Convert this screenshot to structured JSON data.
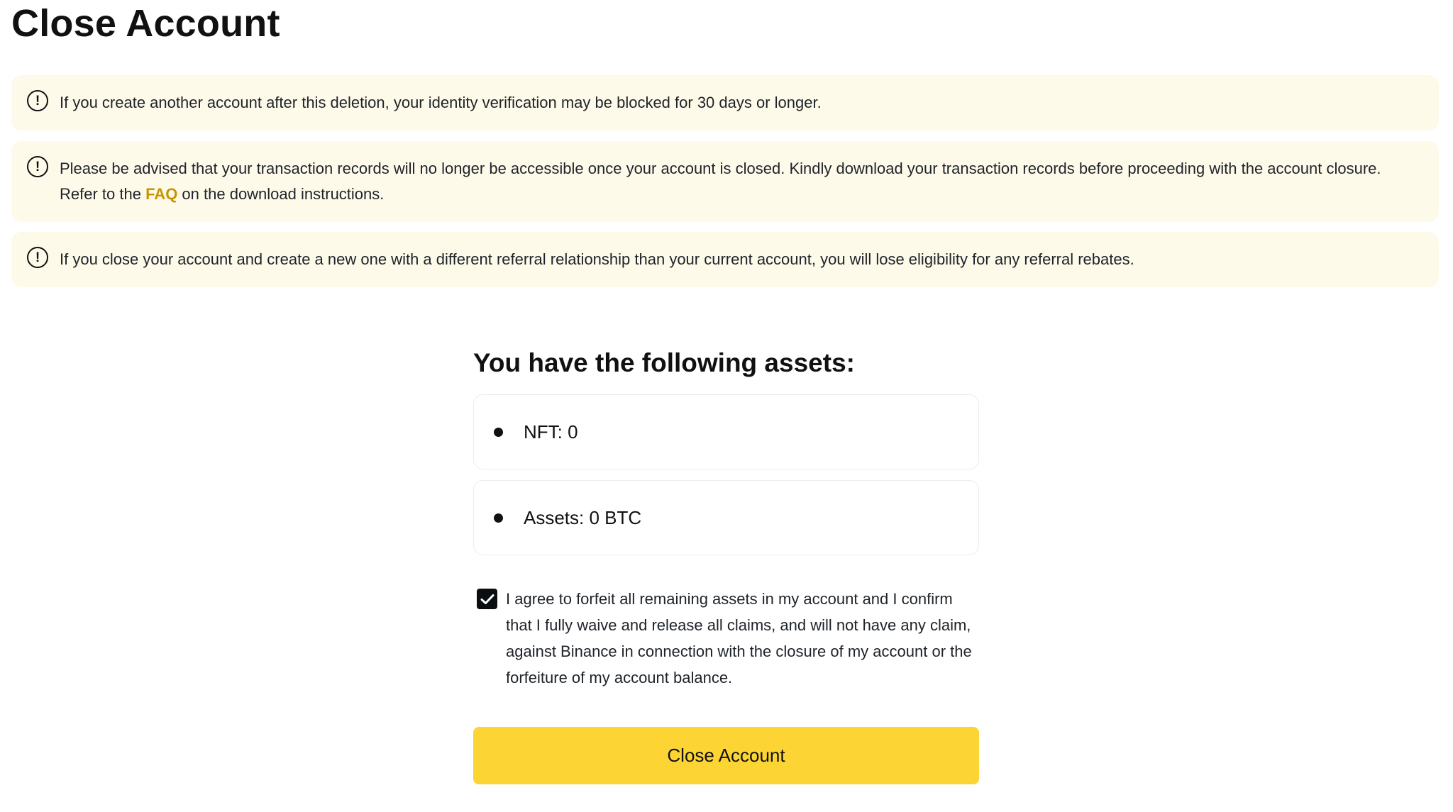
{
  "page": {
    "title": "Close Account"
  },
  "notices": [
    {
      "text": "If you create another account after this deletion, your identity verification may be blocked for 30 days or longer."
    },
    {
      "text_before": "Please be advised that your transaction records will no longer be accessible once your account is closed. Kindly download your transaction records before proceeding with the account closure. Refer to the ",
      "link": "FAQ",
      "text_after": " on the download instructions."
    },
    {
      "text": "If you close your account and create a new one with a different referral relationship than your current account, you will lose eligibility for any referral rebates."
    }
  ],
  "notice_icon": "exclamation-circle-icon",
  "assets": {
    "title": "You have the following assets:",
    "items": [
      {
        "label": "NFT: 0"
      },
      {
        "label": "Assets: 0 BTC"
      }
    ]
  },
  "agreement": {
    "checked": true,
    "text": "I agree to forfeit all remaining assets in my account and I confirm that I fully waive and release all claims, and will not have any claim, against Binance in connection with the closure of my account or the forfeiture of my account balance."
  },
  "actions": {
    "close_label": "Close Account"
  },
  "colors": {
    "notice_bg": "#fefaea",
    "link": "#c99400",
    "primary_button": "#fcd535",
    "checkbox": "#0b0e11"
  }
}
